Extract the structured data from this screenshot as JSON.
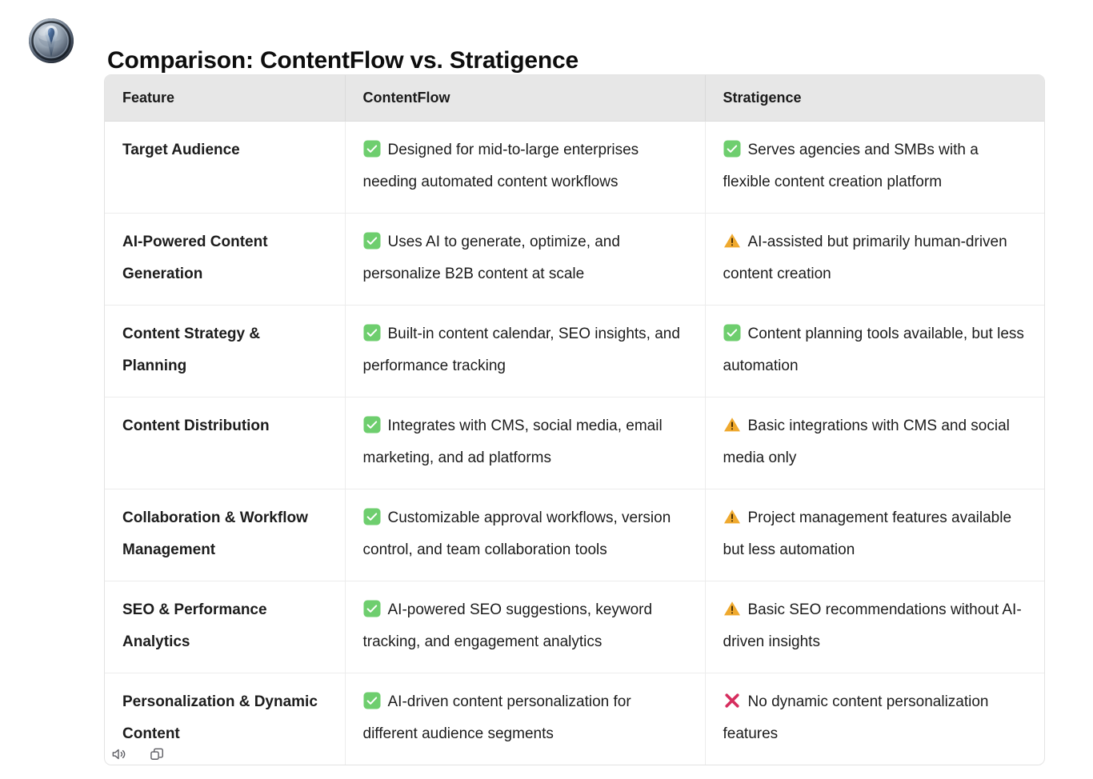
{
  "avatar": {
    "name": "assistant-avatar",
    "alt": "Chrome emblem avatar"
  },
  "header": {
    "title": "Comparison: ContentFlow vs. Stratigence"
  },
  "table": {
    "columns": [
      "Feature",
      "ContentFlow",
      "Stratigence"
    ],
    "rows": [
      {
        "feature": "Target Audience",
        "contentflow": {
          "status": "check",
          "text": "Designed for mid-to-large enterprises needing automated content workflows"
        },
        "stratigence": {
          "status": "check",
          "text": "Serves agencies and SMBs with a flexible content creation platform"
        }
      },
      {
        "feature": "AI-Powered Content Generation",
        "contentflow": {
          "status": "check",
          "text": "Uses AI to generate, optimize, and personalize B2B content at scale"
        },
        "stratigence": {
          "status": "warning",
          "text": "AI-assisted but primarily human-driven content creation"
        }
      },
      {
        "feature": "Content Strategy & Planning",
        "contentflow": {
          "status": "check",
          "text": "Built-in content calendar, SEO insights, and performance tracking"
        },
        "stratigence": {
          "status": "check",
          "text": "Content planning tools available, but less automation"
        }
      },
      {
        "feature": "Content Distribution",
        "contentflow": {
          "status": "check",
          "text": "Integrates with CMS, social media, email marketing, and ad platforms"
        },
        "stratigence": {
          "status": "warning",
          "text": "Basic integrations with CMS and social media only"
        }
      },
      {
        "feature": "Collaboration & Workflow Management",
        "contentflow": {
          "status": "check",
          "text": "Customizable approval workflows, version control, and team collaboration tools"
        },
        "stratigence": {
          "status": "warning",
          "text": "Project management features available but less automation"
        }
      },
      {
        "feature": "SEO & Performance Analytics",
        "contentflow": {
          "status": "check",
          "text": "AI-powered SEO suggestions, keyword tracking, and engagement analytics"
        },
        "stratigence": {
          "status": "warning",
          "text": "Basic SEO recommendations without AI-driven insights"
        }
      },
      {
        "feature": "Personalization & Dynamic Content",
        "contentflow": {
          "status": "check",
          "text": "AI-driven content personalization for different audience segments"
        },
        "stratigence": {
          "status": "cross",
          "text": "No dynamic content personalization features"
        }
      }
    ]
  },
  "footer": {
    "actions": [
      {
        "icon": "speaker-read-aloud-icon",
        "name": "read-aloud-button"
      },
      {
        "icon": "copy-icon",
        "name": "copy-button"
      }
    ]
  },
  "colors": {
    "check_green": "#6ece6e",
    "warning_amber": "#efa92e",
    "cross_crimson": "#d62d5e",
    "header_bg": "#e7e7e7",
    "border": "#ececec",
    "text": "#1c1c1c",
    "icon_gray": "#5d5d63"
  }
}
